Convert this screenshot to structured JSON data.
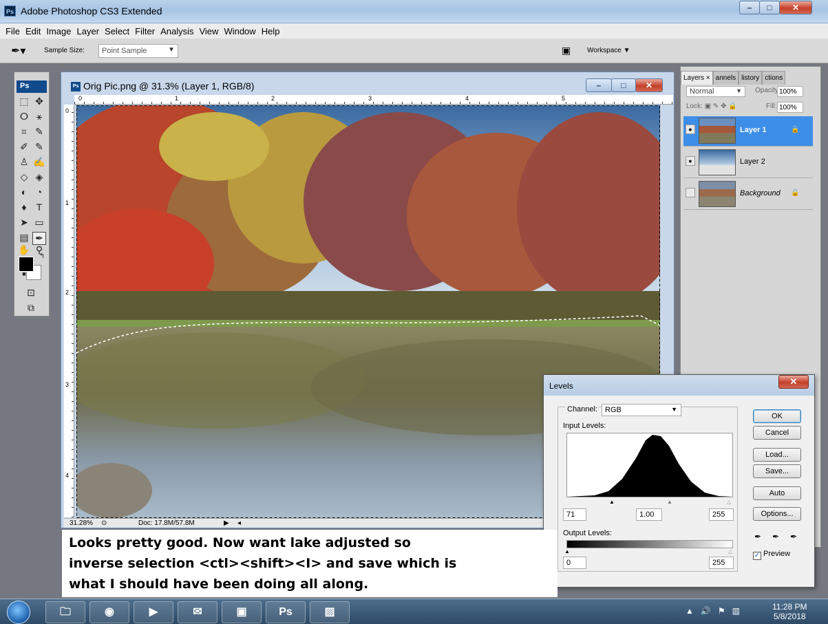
{
  "app": {
    "title": "Adobe Photoshop CS3 Extended",
    "badge": "Ps"
  },
  "menu": [
    "File",
    "Edit",
    "Image",
    "Layer",
    "Select",
    "Filter",
    "Analysis",
    "View",
    "Window",
    "Help"
  ],
  "options_bar": {
    "sample_size_label": "Sample Size:",
    "sample_size_value": "Point Sample",
    "workspace_label": "Workspace"
  },
  "toolbox": {
    "label": "Ps"
  },
  "document": {
    "title": "Orig Pic.png @ 31.3% (Layer 1, RGB/8)",
    "ruler_top": [
      "0",
      "1",
      "2",
      "3",
      "4",
      "5"
    ],
    "ruler_left": [
      "0",
      "1",
      "2",
      "3",
      "4"
    ],
    "zoom": "31.28%",
    "doc_size": "Doc: 17.8M/57.8M"
  },
  "layers_panel": {
    "tabs": [
      "Layers ×",
      "annels",
      "listory",
      "ctions"
    ],
    "blend_mode": "Normal",
    "opacity_label": "Opacity:",
    "opacity_value": "100%",
    "lock_label": "Lock:",
    "fill_label": "Fill:",
    "fill_value": "100%",
    "layers": [
      {
        "name": "Layer 1",
        "visible": true,
        "selected": true,
        "locked": true
      },
      {
        "name": "Layer 2",
        "visible": true,
        "selected": false,
        "locked": false
      },
      {
        "name": "Background",
        "visible": false,
        "selected": false,
        "locked": true
      }
    ]
  },
  "levels": {
    "title": "Levels",
    "channel_label": "Channel:",
    "channel_value": "RGB",
    "input_label": "Input Levels:",
    "input_black": "71",
    "input_gamma": "1.00",
    "input_white": "255",
    "output_label": "Output Levels:",
    "output_black": "0",
    "output_white": "255",
    "buttons": {
      "ok": "OK",
      "cancel": "Cancel",
      "load": "Load...",
      "save": "Save...",
      "auto": "Auto",
      "options": "Options..."
    },
    "preview_label": "Preview",
    "preview_checked": true
  },
  "annotation": {
    "line1": "Looks pretty good.  Now want lake adjusted so",
    "line2": "inverse selection <ctl><shift><I> and save which is",
    "line3": "what I should have been doing all along."
  },
  "taskbar": {
    "time": "11:28 PM",
    "date": "5/8/2018",
    "ps_label": "Ps"
  },
  "colors": {
    "selected_layer": "#3d8ee8",
    "foreground": "#000000",
    "background": "#ffffff"
  }
}
